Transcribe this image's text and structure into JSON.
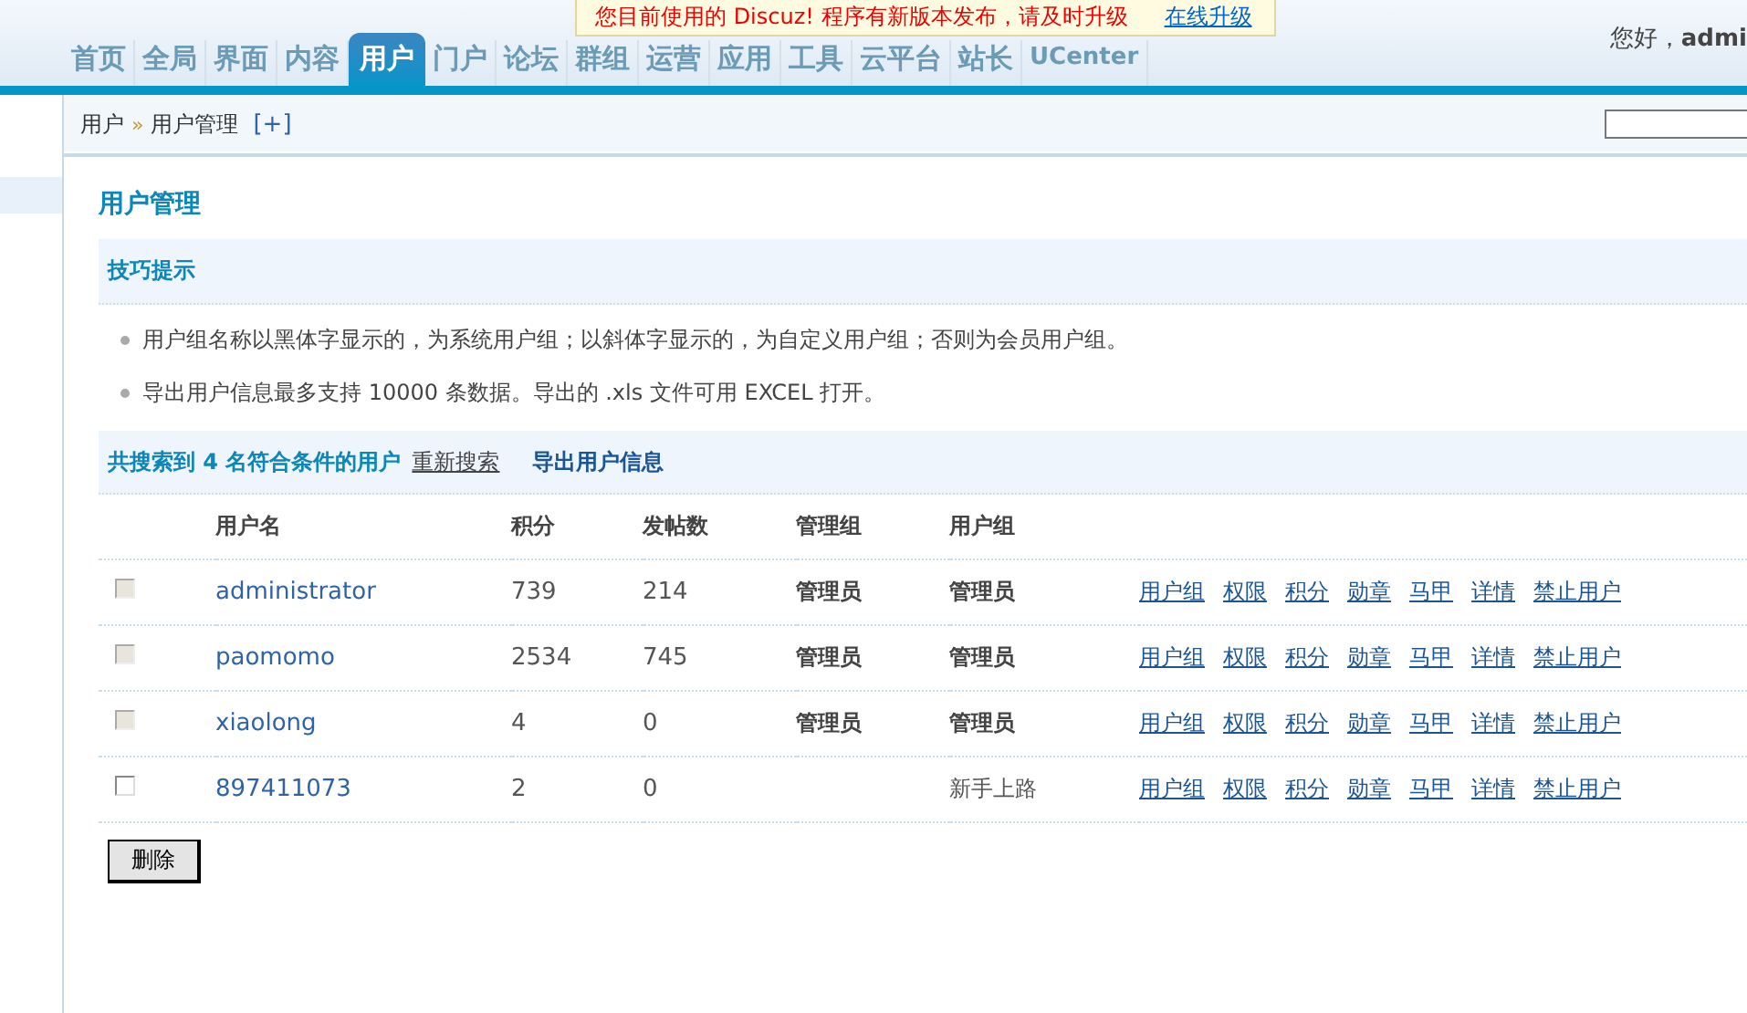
{
  "notice": {
    "text": "您目前使用的 Discuz! 程序有新版本发布，请及时升级",
    "link": "在线升级"
  },
  "greeting": {
    "text": "您好，",
    "user": "admi"
  },
  "nav": [
    {
      "label": "首页",
      "selected": false
    },
    {
      "label": "全局",
      "selected": false
    },
    {
      "label": "界面",
      "selected": false
    },
    {
      "label": "内容",
      "selected": false
    },
    {
      "label": "用户",
      "selected": true
    },
    {
      "label": "门户",
      "selected": false
    },
    {
      "label": "论坛",
      "selected": false
    },
    {
      "label": "群组",
      "selected": false
    },
    {
      "label": "运营",
      "selected": false
    },
    {
      "label": "应用",
      "selected": false
    },
    {
      "label": "工具",
      "selected": false
    },
    {
      "label": "云平台",
      "selected": false
    },
    {
      "label": "站长",
      "selected": false
    },
    {
      "label": "UCenter",
      "selected": false
    }
  ],
  "breadcrumb": {
    "parent": "用户",
    "separator": "»",
    "current": "用户管理",
    "add": "[+]"
  },
  "page_title": "用户管理",
  "tips": {
    "title": "技巧提示",
    "items": [
      "用户组名称以黑体字显示的，为系统用户组；以斜体字显示的，为自定义用户组；否则为会员用户组。",
      "导出用户信息最多支持 10000 条数据。导出的 .xls 文件可用 EXCEL 打开。"
    ]
  },
  "result": {
    "summary": "共搜索到 4 名符合条件的用户",
    "research": "重新搜索",
    "export": "导出用户信息"
  },
  "table": {
    "columns": [
      "用户名",
      "积分",
      "发帖数",
      "管理组",
      "用户组"
    ],
    "rows": [
      {
        "disabled": true,
        "checked": false,
        "username": "administrator",
        "credits": "739",
        "posts": "214",
        "admin_group": "管理员",
        "user_group": "管理员",
        "system_group": true,
        "actions": [
          "用户组",
          "权限",
          "积分",
          "勋章",
          "马甲",
          "详情",
          "禁止用户"
        ]
      },
      {
        "disabled": true,
        "checked": false,
        "username": "paomomo",
        "credits": "2534",
        "posts": "745",
        "admin_group": "管理员",
        "user_group": "管理员",
        "system_group": true,
        "actions": [
          "用户组",
          "权限",
          "积分",
          "勋章",
          "马甲",
          "详情",
          "禁止用户"
        ]
      },
      {
        "disabled": true,
        "checked": false,
        "username": "xiaolong",
        "credits": "4",
        "posts": "0",
        "admin_group": "管理员",
        "user_group": "管理员",
        "system_group": true,
        "actions": [
          "用户组",
          "权限",
          "积分",
          "勋章",
          "马甲",
          "详情",
          "禁止用户"
        ]
      },
      {
        "disabled": false,
        "checked": false,
        "username": "897411073",
        "credits": "2",
        "posts": "0",
        "user_group": "新手上路",
        "system_group": false,
        "actions": [
          "用户组",
          "权限",
          "积分",
          "勋章",
          "马甲",
          "详情",
          "禁止用户"
        ]
      }
    ]
  },
  "delete_button": "删除"
}
